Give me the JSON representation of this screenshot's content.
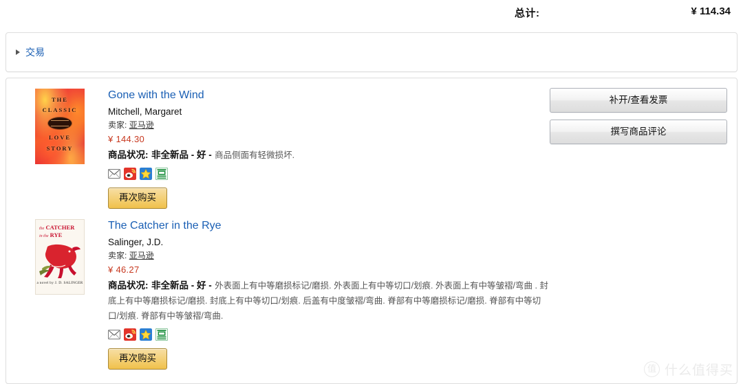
{
  "totals": {
    "label": "总计:",
    "amount": "¥ 114.34"
  },
  "transactions": {
    "label": "交易"
  },
  "items": [
    {
      "title": "Gone with the Wind",
      "author": "Mitchell, Margaret",
      "seller_label": "卖家:",
      "seller_name": "亚马逊",
      "price": "¥ 144.30",
      "condition_label": "商品状况:",
      "condition_grade": "非全新品 - 好 -",
      "condition_desc": "商品侧面有轻微损坏.",
      "buy_again_label": "再次购买",
      "cover": {
        "line1": "THE",
        "line2": "CLASSIC",
        "line3": "LOVE",
        "line4": "STORY"
      },
      "share_icons": [
        {
          "name": "email-share-icon",
          "title": "邮件"
        },
        {
          "name": "sina-weibo-share-icon",
          "title": "新浪微博"
        },
        {
          "name": "qzone-share-icon",
          "title": "QQ空间"
        },
        {
          "name": "douban-share-icon",
          "title": "豆瓣"
        }
      ]
    },
    {
      "title": "The Catcher in the Rye",
      "author": "Salinger, J.D.",
      "seller_label": "卖家:",
      "seller_name": "亚马逊",
      "price": "¥ 46.27",
      "condition_label": "商品状况:",
      "condition_grade": "非全新品 - 好 -",
      "condition_desc": "外表面上有中等磨损标记/磨损. 外表面上有中等切口/划痕. 外表面上有中等皱褶/弯曲 . 封底上有中等磨损标记/磨损. 封底上有中等切口/划痕. 后盖有中度皱褶/弯曲. 脊部有中等磨损标记/磨损. 脊部有中等切口/划痕. 脊部有中等皱褶/弯曲.",
      "buy_again_label": "再次购买",
      "cover": {
        "line1": "the CATCHER",
        "line2": "in the RYE",
        "author_credit": "a novel by  J. D. SALINGER"
      },
      "share_icons": [
        {
          "name": "email-share-icon",
          "title": "邮件"
        },
        {
          "name": "sina-weibo-share-icon",
          "title": "新浪微博"
        },
        {
          "name": "qzone-share-icon",
          "title": "QQ空间"
        },
        {
          "name": "douban-share-icon",
          "title": "豆瓣"
        }
      ]
    }
  ],
  "actions": {
    "invoice_label": "补开/查看发票",
    "review_label": "撰写商品评论"
  },
  "watermark": {
    "mark": "值",
    "text": "什么值得买"
  },
  "colors": {
    "link": "#1a5fb4",
    "price": "#c7381f",
    "button_gold": "#f0c14b",
    "card_border": "#dddddd"
  }
}
